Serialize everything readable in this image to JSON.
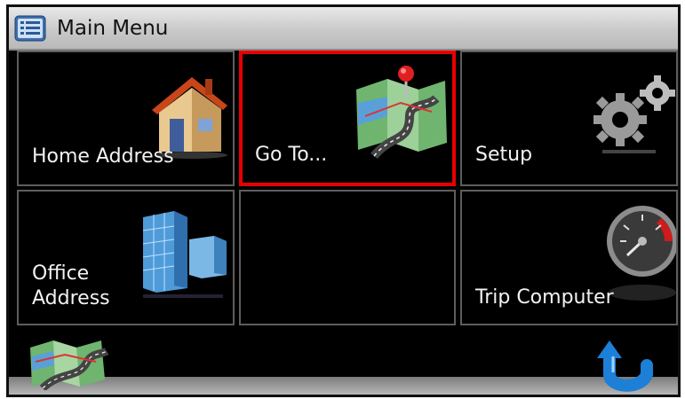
{
  "window": {
    "title": "Main Menu",
    "menu_icon": "menu-list-icon"
  },
  "tiles": [
    {
      "label": "Home Address",
      "icon": "house-icon"
    },
    {
      "label": "Go To...",
      "icon": "map-pin-icon",
      "selected": true
    },
    {
      "label": "Setup",
      "icon": "gears-icon"
    },
    {
      "label_lines": [
        "Office",
        "Address"
      ],
      "icon": "office-building-icon"
    },
    {
      "label": "",
      "icon": ""
    },
    {
      "label": "Trip Computer",
      "icon": "speedometer-icon"
    }
  ],
  "bottom_bar": {
    "left_button_icon": "map-icon",
    "right_button_icon": "back-arrow-icon"
  },
  "colors": {
    "selection_border": "#e80000",
    "tile_border": "#5e5e5e",
    "background": "#000000"
  }
}
